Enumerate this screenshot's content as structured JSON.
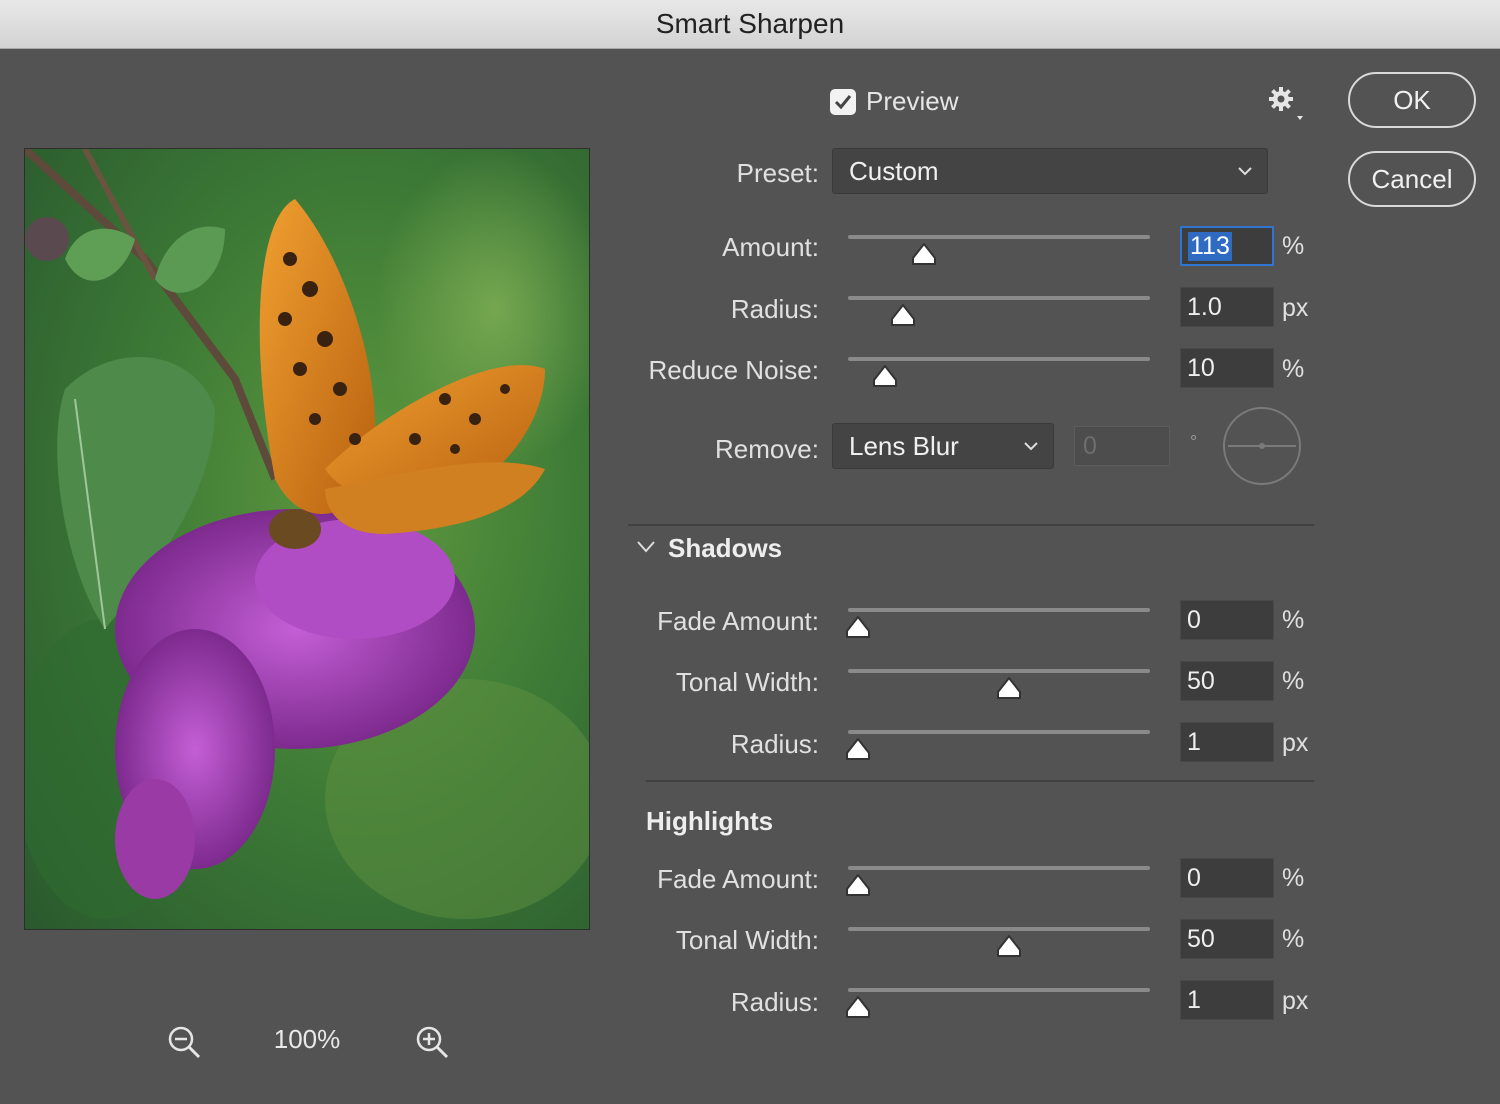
{
  "window": {
    "title": "Smart Sharpen"
  },
  "preview": {
    "label": "Preview",
    "checked": true,
    "zoom_level": "100%"
  },
  "buttons": {
    "ok": "OK",
    "cancel": "Cancel"
  },
  "preset": {
    "label": "Preset:",
    "value": "Custom"
  },
  "sharpen": {
    "amount": {
      "label": "Amount:",
      "value": "113",
      "unit": "%",
      "slider_fraction": 0.22
    },
    "radius": {
      "label": "Radius:",
      "value": "1.0",
      "unit": "px",
      "slider_fraction": 0.15
    },
    "reduce_noise": {
      "label": "Reduce Noise:",
      "value": "10",
      "unit": "%",
      "slider_fraction": 0.09
    }
  },
  "remove": {
    "label": "Remove:",
    "value": "Lens Blur",
    "angle": "0",
    "angle_unit": "°"
  },
  "shadows": {
    "title": "Shadows",
    "fade_amount": {
      "label": "Fade Amount:",
      "value": "0",
      "unit": "%",
      "slider_fraction": 0.0
    },
    "tonal_width": {
      "label": "Tonal Width:",
      "value": "50",
      "unit": "%",
      "slider_fraction": 0.5
    },
    "radius": {
      "label": "Radius:",
      "value": "1",
      "unit": "px",
      "slider_fraction": 0.0
    }
  },
  "highlights": {
    "title": "Highlights",
    "fade_amount": {
      "label": "Fade Amount:",
      "value": "0",
      "unit": "%",
      "slider_fraction": 0.0
    },
    "tonal_width": {
      "label": "Tonal Width:",
      "value": "50",
      "unit": "%",
      "slider_fraction": 0.5
    },
    "radius": {
      "label": "Radius:",
      "value": "1",
      "unit": "px",
      "slider_fraction": 0.0
    }
  },
  "icons": {
    "zoom_out": "zoom-out-icon",
    "zoom_in": "zoom-in-icon",
    "settings": "gear-icon"
  },
  "colors": {
    "dialog_bg": "#535353",
    "accent": "#2f74d0",
    "field_bg": "#3d3d3d"
  }
}
